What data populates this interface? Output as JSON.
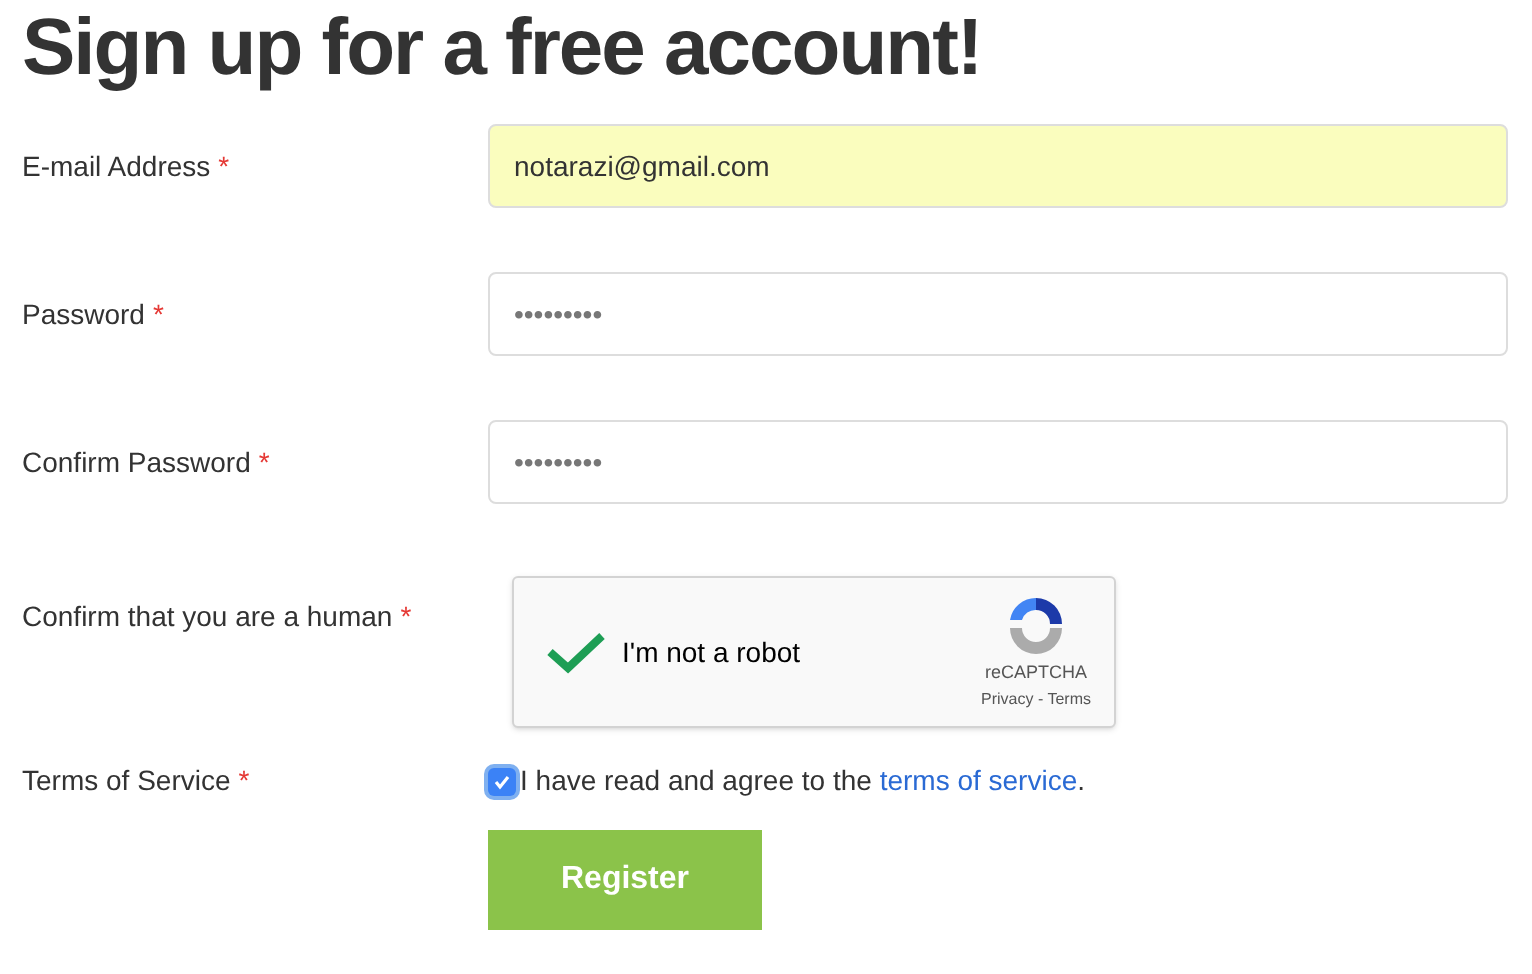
{
  "title": "Sign up for a free account!",
  "fields": [
    {
      "kind": "input",
      "label": "E-mail Address",
      "required": "*",
      "value": "notarazi@gmail.com",
      "autofilled": true
    },
    {
      "kind": "input",
      "label": "Password",
      "required": "*",
      "value": "•••••••••",
      "autofilled": false
    },
    {
      "kind": "input",
      "label": "Confirm Password",
      "required": "*",
      "value": "•••••••••",
      "autofilled": false
    },
    {
      "kind": "captcha",
      "label": "Confirm that you are a human",
      "required": "*",
      "checked": true,
      "text": "I'm not a robot",
      "brand": "reCAPTCHA",
      "links": "Privacy - Terms"
    },
    {
      "kind": "terms",
      "label": "Terms of Service",
      "required": "*",
      "checked": true,
      "text": "I have read and agree to the ",
      "link": "terms of service",
      "after": "."
    }
  ],
  "submit": {
    "label": "Register"
  }
}
